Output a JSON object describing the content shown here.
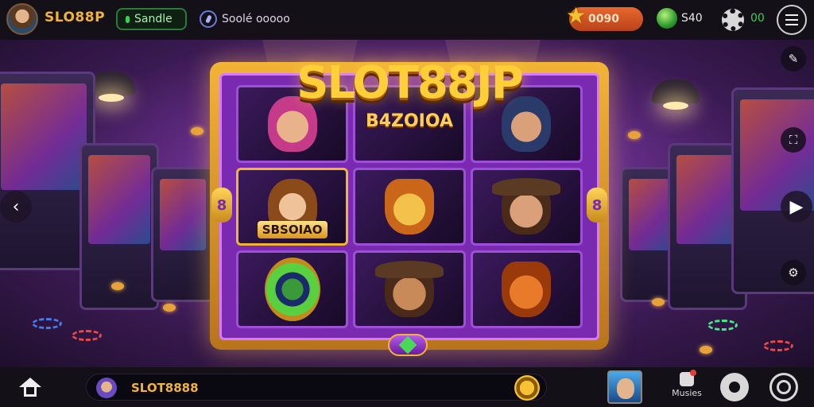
{
  "topbar": {
    "brand": "SLO88P",
    "mode_pill": "Sandle",
    "search_label": "Soolé ooooo",
    "coins": "0090",
    "gems": "S40",
    "settings_count": "00"
  },
  "machine": {
    "title": "SLOT88JP",
    "reel_label_top": "B4ZOIOA",
    "reel_label_left": "SBSOIAO",
    "side_gem_left": "8",
    "side_gem_right": "8"
  },
  "bottombar": {
    "player_name": "SLOT8888",
    "music_label": "Musies"
  },
  "colors": {
    "accent_gold": "#f2b437",
    "accent_purple": "#7a2ab0",
    "accent_green": "#35d15a",
    "coin_orange": "#e8682e"
  },
  "icons": {
    "home": "home-icon",
    "menu": "menu-icon",
    "search": "search-icon",
    "settings": "gear-icon",
    "star": "star-icon",
    "gem": "gem-icon"
  }
}
